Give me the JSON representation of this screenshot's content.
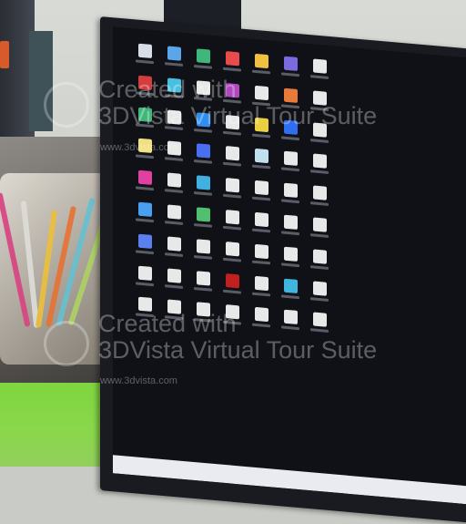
{
  "watermarks": [
    {
      "line1": "Created with",
      "line2": "3DVista Virtual Tour Suite",
      "url": "www.3dvista.com"
    },
    {
      "line1": "Created with",
      "line2": "3DVista Virtual Tour Suite",
      "url": "www.3dvista.com"
    }
  ],
  "scene": {
    "colors": {
      "wall": "#d3d5d0",
      "desk": "#6a6661",
      "mat": "#84d548",
      "monitor_bezel": "#1a1b20",
      "desktop_background": "#0f1117",
      "taskbar": "#e9ebf0"
    },
    "desktop_icon_colors": [
      "#d8dde6",
      "#5aa6e8",
      "#3fb67a",
      "#e84b4b",
      "#f0c040",
      "#7b6be0",
      "#e8e8e8",
      "#d43d3d",
      "#4ac0e0",
      "#e8e8e8",
      "#b048c0",
      "#e8e8e8",
      "#e87a3a",
      "#e8e8e8",
      "#3fb67a",
      "#e8e8e8",
      "#2f8ef0",
      "#e8e8e8",
      "#e8d040",
      "#2f6ef0",
      "#e8e8e8",
      "#f0e080",
      "#e8e8e8",
      "#4a6ef0",
      "#e8e8e8",
      "#c0e0f0",
      "#e8e8e8",
      "#e8e8e8",
      "#e040a0",
      "#e8e8e8",
      "#40b0e0",
      "#e8e8e8",
      "#e8e8e8",
      "#e8e8e8",
      "#e8e8e8",
      "#4aa0f0",
      "#e8e8e8",
      "#50c070",
      "#e8e8e8",
      "#e8e8e8",
      "#e8e8e8",
      "#e8e8e8",
      "#5a80f0",
      "#e8e8e8",
      "#e8e8e8",
      "#e8e8e8",
      "#e8e8e8",
      "#e8e8e8",
      "#e8e8e8",
      "#e8e8e8",
      "#e8e8e8",
      "#e8e8e8",
      "#c02020",
      "#e8e8e8",
      "#3fb6e0",
      "#e8e8e8",
      "#e8e8e8",
      "#e8e8e8",
      "#e8e8e8",
      "#e8e8e8",
      "#e8e8e8",
      "#e8e8e8",
      "#e8e8e8"
    ]
  }
}
